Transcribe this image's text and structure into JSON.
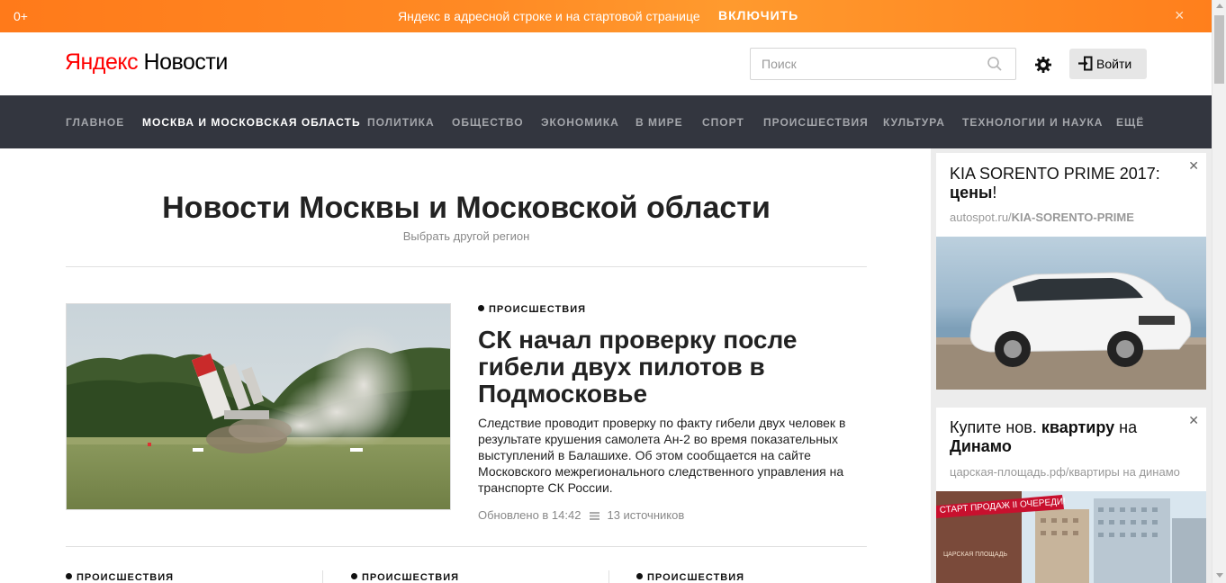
{
  "promo": {
    "age": "0+",
    "message": "Яндекс в адресной строке и на стартовой странице",
    "enable": "ВКЛЮЧИТЬ",
    "close": "×"
  },
  "header": {
    "logo_brand": "Яндекс",
    "logo_section": "Новости",
    "search_placeholder": "Поиск",
    "login": "Войти"
  },
  "nav": {
    "items": [
      "ГЛАВНОЕ",
      "МОСКВА И МОСКОВСКАЯ ОБЛАСТЬ",
      "ПОЛИТИКА",
      "ОБЩЕСТВО",
      "ЭКОНОМИКА",
      "В МИРЕ",
      "СПОРТ",
      "ПРОИСШЕСТВИЯ",
      "КУЛЬТУРА",
      "ТЕХНОЛОГИИ И НАУКА",
      "ЕЩЁ"
    ],
    "active": "МОСКВА И МОСКОВСКАЯ ОБЛАСТЬ"
  },
  "main": {
    "title": "Новости Москвы и Московской области",
    "region_link": "Выбрать другой регион",
    "hero": {
      "rubric": "ПРОИСШЕСТВИЯ",
      "title": "СК начал проверку после гибели двух пилотов в Подмосковье",
      "text": "Следствие проводит проверку по факту гибели двух человек в результате крушения самолета Ан-2 во время показательных выступлений в Балашихе. Об этом сообщается на сайте Московского межрегионального следственного управления на транспорте СК России.",
      "updated": "Обновлено в 14:42",
      "sources": "13 источников"
    },
    "bottom_rubrics": [
      "ПРОИСШЕСТВИЯ",
      "ПРОИСШЕСТВИЯ",
      "ПРОИСШЕСТВИЯ"
    ]
  },
  "ads": [
    {
      "title_plain": "KIA SORENTO PRIME 2017: ",
      "title_bold": "цены",
      "title_tail": "!",
      "url_plain": "autospot.ru/",
      "url_bold": "KIA-SORENTO-PRIME"
    },
    {
      "title_p1": "Купите нов. ",
      "title_b1": "квартиру",
      "title_p2": " на ",
      "title_b2": "Динамо",
      "url": "царская-площадь.рф/квартиры на динамо",
      "banner_text": "СТАРТ ПРОДАЖ II ОЧЕРЕДИ!",
      "logo_text": "ЦАРСКАЯ ПЛОЩАДЬ"
    }
  ],
  "colors": {
    "promo": "#ff8a24",
    "nav_bg": "#33363f",
    "logo_accent": "#ff0000"
  }
}
